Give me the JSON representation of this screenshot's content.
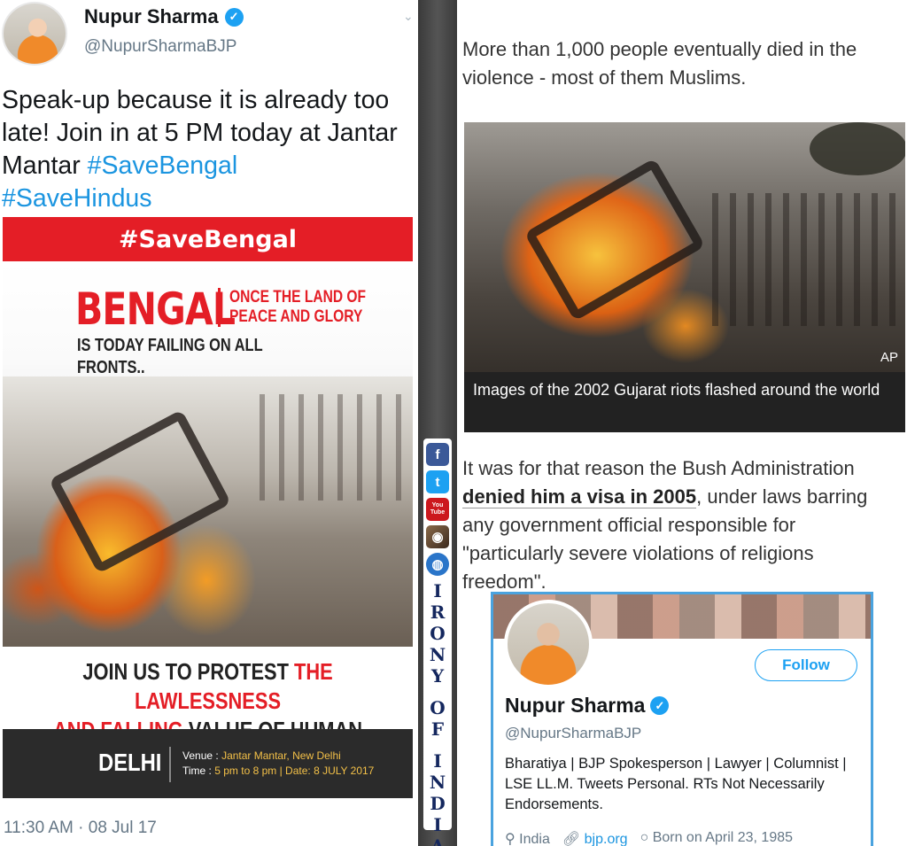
{
  "left_tweet": {
    "author_name": "Nupur Sharma",
    "author_handle": "@NupurSharmaBJP",
    "text_plain": "Speak-up because it is already too late! Join in at 5 PM today at Jantar Mantar ",
    "hashtag1": "#SaveBengal",
    "hashtag2": "#SaveHindus",
    "timestamp": "11:30 AM · 08 Jul 17"
  },
  "poster": {
    "banner": "#SaveBengal",
    "headline_big": "BENGAL",
    "headline_side": "ONCE THE LAND OF PEACE AND GLORY",
    "headline_sub": "IS TODAY FAILING ON ALL FRONTS..",
    "protest_part1": "JOIN US TO PROTEST ",
    "protest_part2": "THE LAWLESSNESS",
    "protest_part3": "AND FALLING ",
    "protest_part4": "VALUE OF HUMAN LIFE..",
    "city": "DELHI",
    "venue_label": "Venue  :",
    "venue_value": "Jantar Mantar, New Delhi",
    "time_label": "Time    :",
    "time_value": "5 pm to 8 pm | Date: 8 JULY 2017"
  },
  "strip": {
    "facebook": "f",
    "twitter": "t",
    "youtube": "You Tube",
    "irony_letters": [
      "I",
      "R",
      "O",
      "N",
      "Y",
      "",
      "O",
      "F",
      "",
      "I",
      "N",
      "D",
      "I",
      "A"
    ]
  },
  "right_article": {
    "para1": "More than 1,000 people eventually died in the violence - most of them Muslims.",
    "photo_credit": "AP",
    "caption": "Images of the 2002 Gujarat riots flashed around the world",
    "para2_start": "It was for that reason the Bush Administration ",
    "para2_link": "denied him a visa in 2005",
    "para2_end": ", under laws barring any government official responsible for \"particularly severe violations of religions freedom\"."
  },
  "profile_card": {
    "follow_label": "Follow",
    "name": "Nupur Sharma",
    "handle": "@NupurSharmaBJP",
    "bio": "Bharatiya | BJP Spokesperson | Lawyer | Columnist | LSE LL.M. Tweets Personal. RTs Not Necessarily Endorsements.",
    "location": "India",
    "website": "bjp.org",
    "born": "Born on April 23, 1985"
  },
  "colors": {
    "twitter_blue": "#1da1f2",
    "hashtag_blue": "#1b95e0",
    "poster_red": "#e41e26",
    "card_border": "#4aa3df"
  },
  "icons": [
    "verified-badge-icon",
    "chevron-down-icon",
    "facebook-icon",
    "twitter-icon",
    "youtube-icon",
    "instagram-icon",
    "globe-icon",
    "location-pin-icon",
    "link-icon",
    "birthday-icon"
  ]
}
